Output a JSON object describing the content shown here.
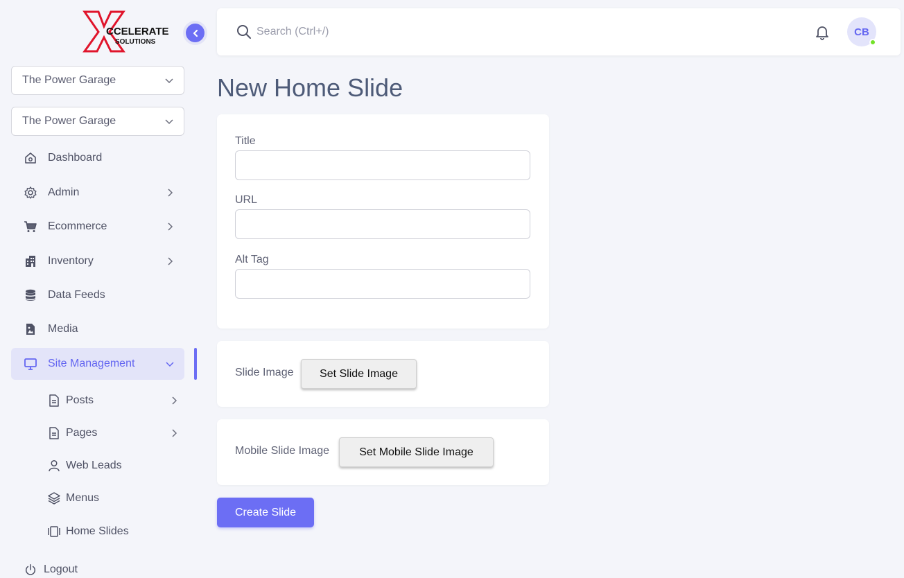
{
  "brand": {
    "logo_line1": "CCELERATE",
    "logo_line2": "SOLUTIONS"
  },
  "selectors": [
    {
      "value": "The Power Garage"
    },
    {
      "value": "The Power Garage"
    }
  ],
  "sidebar": {
    "items": [
      {
        "label": "Dashboard",
        "icon": "home-icon"
      },
      {
        "label": "Admin",
        "icon": "gear-icon"
      },
      {
        "label": "Ecommerce",
        "icon": "cart-icon"
      },
      {
        "label": "Inventory",
        "icon": "building-icon"
      },
      {
        "label": "Data Feeds",
        "icon": "database-icon"
      },
      {
        "label": "Media",
        "icon": "image-file-icon"
      },
      {
        "label": "Site Management",
        "icon": "monitor-icon"
      }
    ],
    "subitems": [
      {
        "label": "Posts",
        "icon": "document-icon"
      },
      {
        "label": "Pages",
        "icon": "document-icon"
      },
      {
        "label": "Web Leads",
        "icon": "user-icon"
      },
      {
        "label": "Menus",
        "icon": "layers-icon"
      },
      {
        "label": "Home Slides",
        "icon": "slides-icon"
      }
    ],
    "logout": "Logout"
  },
  "header": {
    "search_placeholder": "Search (Ctrl+/)",
    "avatar_initials": "CB"
  },
  "page": {
    "title": "New Home Slide",
    "fields": {
      "title_label": "Title",
      "url_label": "URL",
      "alt_label": "Alt Tag"
    },
    "slide_image_label": "Slide Image",
    "set_slide_image": "Set Slide Image",
    "mobile_slide_image_label": "Mobile Slide Image",
    "set_mobile_slide_image": "Set Mobile Slide Image",
    "create_button": "Create Slide"
  },
  "colors": {
    "accent": "#6c6ef4",
    "online": "#72e128",
    "logo_red": "#e0142b",
    "logo_blue": "#3b2bd6"
  }
}
